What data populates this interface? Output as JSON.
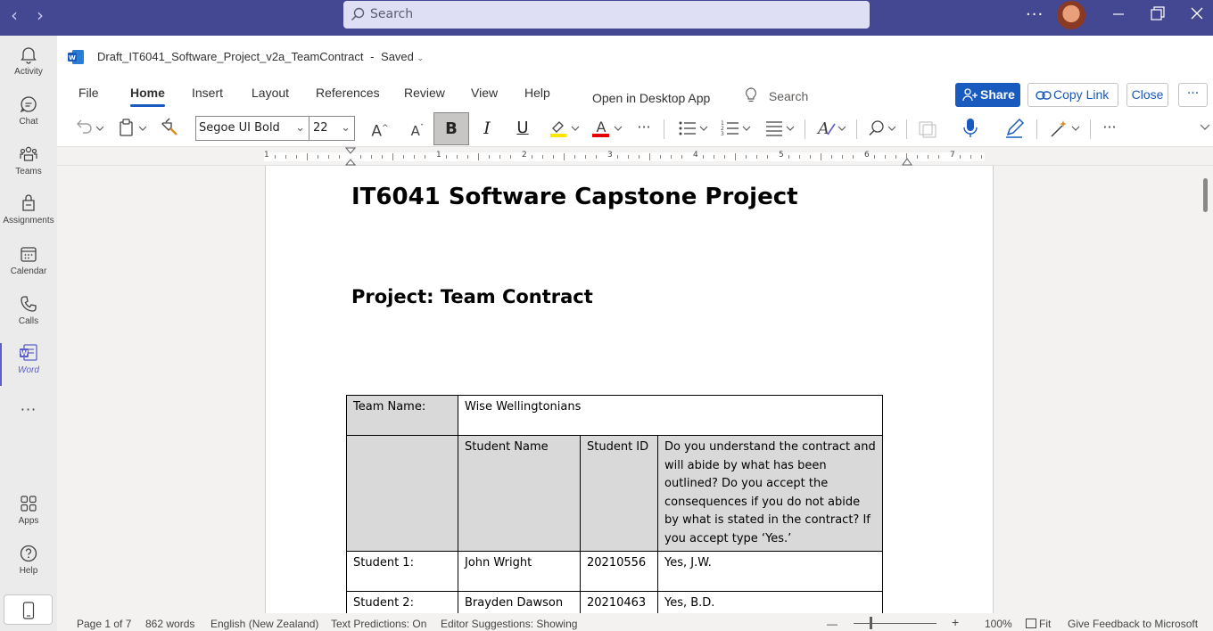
{
  "titlebar": {
    "back": "‹",
    "forward": "›",
    "search_placeholder": "Search",
    "more": "···",
    "minimize": "—",
    "maximize": "❐",
    "close": "✕"
  },
  "rail": {
    "items": [
      {
        "label": "Activity",
        "icon": "bell-icon"
      },
      {
        "label": "Chat",
        "icon": "chat-icon"
      },
      {
        "label": "Teams",
        "icon": "teams-icon"
      },
      {
        "label": "Assignments",
        "icon": "assignments-icon"
      },
      {
        "label": "Calendar",
        "icon": "calendar-icon"
      },
      {
        "label": "Calls",
        "icon": "phone-icon"
      },
      {
        "label": "Word",
        "icon": "word-icon"
      },
      {
        "label": "Apps",
        "icon": "apps-icon"
      },
      {
        "label": "Help",
        "icon": "help-icon"
      }
    ],
    "more": "···"
  },
  "document": {
    "filename": "Draft_IT6041_Software_Project_v2a_TeamContract",
    "save_state": "Saved"
  },
  "ribbon": {
    "tabs": [
      "File",
      "Home",
      "Insert",
      "Layout",
      "References",
      "Review",
      "View",
      "Help"
    ],
    "active_tab": "Home",
    "open_desktop": "Open in Desktop App",
    "search_label": "Search",
    "share": "Share",
    "copy_link": "Copy Link",
    "close": "Close",
    "more": "···"
  },
  "toolbar": {
    "font": "Segoe UI Bold",
    "size": "22",
    "bold": "B",
    "italic": "I",
    "underline": "U",
    "grow": "A",
    "shrink": "A",
    "overflow": "···",
    "highlight_color": "#ffe500",
    "font_color": "#e00000"
  },
  "ruler": {
    "numbers": [
      "1",
      "1",
      "2",
      "3",
      "4",
      "5",
      "6",
      "7"
    ]
  },
  "page": {
    "title": "IT6041 Software Capstone Project",
    "subtitle": "Project: Team Contract",
    "table": {
      "team_label": "Team Name:",
      "team_name": "Wise Wellingtonians",
      "headers": [
        "Student Name",
        "Student ID",
        "Do you understand the contract and will abide by what has been outlined? Do you accept the consequences if you do not abide by what is stated in the contract? If you accept type ‘Yes.’"
      ],
      "rows": [
        {
          "label": "Student 1:",
          "name": "John Wright",
          "id": "20210556",
          "answer": "Yes, J.W."
        },
        {
          "label": "Student 2:",
          "name": "Brayden Dawson",
          "id": "20210463",
          "answer": "Yes, B.D."
        }
      ]
    }
  },
  "statusbar": {
    "page": "Page 1 of 7",
    "words": "862 words",
    "language": "English (New Zealand)",
    "predictions": "Text Predictions: On",
    "editor": "Editor Suggestions: Showing",
    "zoom_out": "—",
    "zoom_in": "+",
    "zoom": "100%",
    "fit": "Fit",
    "feedback": "Give Feedback to Microsoft"
  },
  "colors": {
    "teams_purple": "#444791",
    "word_blue": "#185abd",
    "table_shade": "#d9d9d9"
  }
}
